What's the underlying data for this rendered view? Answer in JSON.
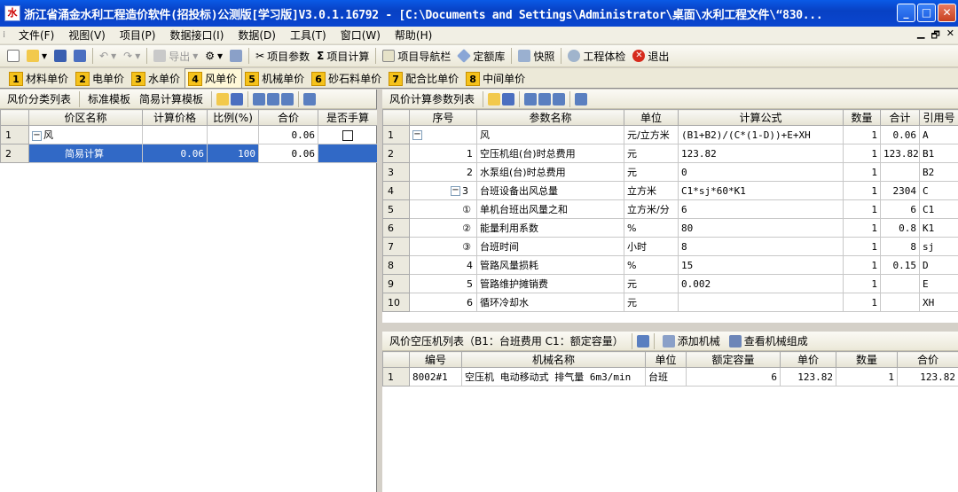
{
  "window": {
    "title": "浙江省涌金水利工程造价软件(招投标)公测版[学习版]V3.0.1.16792 - [C:\\Documents and Settings\\Administrator\\桌面\\水利工程文件\\“830...",
    "app_icon_label": "水"
  },
  "menu": [
    "文件(F)",
    "视图(V)",
    "项目(P)",
    "数据接口(I)",
    "数据(D)",
    "工具(T)",
    "窗口(W)",
    "帮助(H)"
  ],
  "mdi_controls": [
    "▁",
    "🗗",
    "✕"
  ],
  "toolbar": {
    "export": "导出",
    "project_params": "项目参数",
    "project_calc": "项目计算",
    "project_nav": "项目导航栏",
    "quota_lib": "定额库",
    "snapshot": "快照",
    "project_check": "工程体检",
    "exit": "退出",
    "sigma": "Σ"
  },
  "tabs": [
    {
      "num": "1",
      "label": "材料单价"
    },
    {
      "num": "2",
      "label": "电单价"
    },
    {
      "num": "3",
      "label": "水单价"
    },
    {
      "num": "4",
      "label": "风单价"
    },
    {
      "num": "5",
      "label": "机械单价"
    },
    {
      "num": "6",
      "label": "砂石料单价"
    },
    {
      "num": "7",
      "label": "配合比单价"
    },
    {
      "num": "8",
      "label": "中间单价"
    }
  ],
  "left": {
    "toolbar": [
      "风价分类列表",
      "标准模板",
      "简易计算模板"
    ],
    "columns": [
      "",
      "价区名称",
      "计算价格",
      "比例(%)",
      "合价",
      "是否手算"
    ],
    "rows": [
      {
        "no": "1",
        "name": "风",
        "price": "",
        "ratio": "",
        "total": "0.06"
      },
      {
        "no": "2",
        "name": "简易计算",
        "price": "0.06",
        "ratio": "100",
        "total": "0.06"
      }
    ]
  },
  "right": {
    "toolbar_label": "风价计算参数列表",
    "columns": [
      "",
      "序号",
      "参数名称",
      "单位",
      "计算公式",
      "数量",
      "合计",
      "引用号"
    ],
    "rows": [
      {
        "no": "1",
        "seq": "",
        "name": "风",
        "unit": "元/立方米",
        "formula": "(B1+B2)/(C*(1-D))+E+XH",
        "qty": "1",
        "total": "0.06",
        "ref": "A"
      },
      {
        "no": "2",
        "seq": "1",
        "name": "空压机组(台)时总费用",
        "unit": "元",
        "formula": "123.82",
        "qty": "1",
        "total": "123.82",
        "ref": "B1"
      },
      {
        "no": "3",
        "seq": "2",
        "name": "水泵组(台)时总费用",
        "unit": "元",
        "formula": "0",
        "qty": "1",
        "total": "",
        "ref": "B2"
      },
      {
        "no": "4",
        "seq": "3",
        "name": "台班设备出风总量",
        "unit": "立方米",
        "formula": "C1*sj*60*K1",
        "qty": "1",
        "total": "2304",
        "ref": "C"
      },
      {
        "no": "5",
        "seq": "①",
        "name": "单机台班出风量之和",
        "unit": "立方米/分",
        "formula": "6",
        "qty": "1",
        "total": "6",
        "ref": "C1"
      },
      {
        "no": "6",
        "seq": "②",
        "name": "能量利用系数",
        "unit": "%",
        "formula": "80",
        "qty": "1",
        "total": "0.8",
        "ref": "K1"
      },
      {
        "no": "7",
        "seq": "③",
        "name": "台班时间",
        "unit": "小时",
        "formula": "8",
        "qty": "1",
        "total": "8",
        "ref": "sj"
      },
      {
        "no": "8",
        "seq": "4",
        "name": "管路风量损耗",
        "unit": "%",
        "formula": "15",
        "qty": "1",
        "total": "0.15",
        "ref": "D"
      },
      {
        "no": "9",
        "seq": "5",
        "name": "管路维护摊销费",
        "unit": "元",
        "formula": "0.002",
        "qty": "1",
        "total": "",
        "ref": "E"
      },
      {
        "no": "10",
        "seq": "6",
        "name": "循环冷却水",
        "unit": "元",
        "formula": "",
        "qty": "1",
        "total": "",
        "ref": "XH"
      }
    ]
  },
  "lower": {
    "toolbar_label": "风价空压机列表（B1：台班费用 C1：额定容量）",
    "add_machine": "添加机械",
    "view_machine": "查看机械组成",
    "columns": [
      "",
      "编号",
      "机械名称",
      "单位",
      "额定容量",
      "单价",
      "数量",
      "合价"
    ],
    "rows": [
      {
        "no": "1",
        "code": "8002#1",
        "name": "空压机 电动移动式 排气量 6m3/min",
        "unit": "台班",
        "capacity": "6",
        "price": "123.82",
        "qty": "1",
        "total": "123.82"
      }
    ]
  }
}
